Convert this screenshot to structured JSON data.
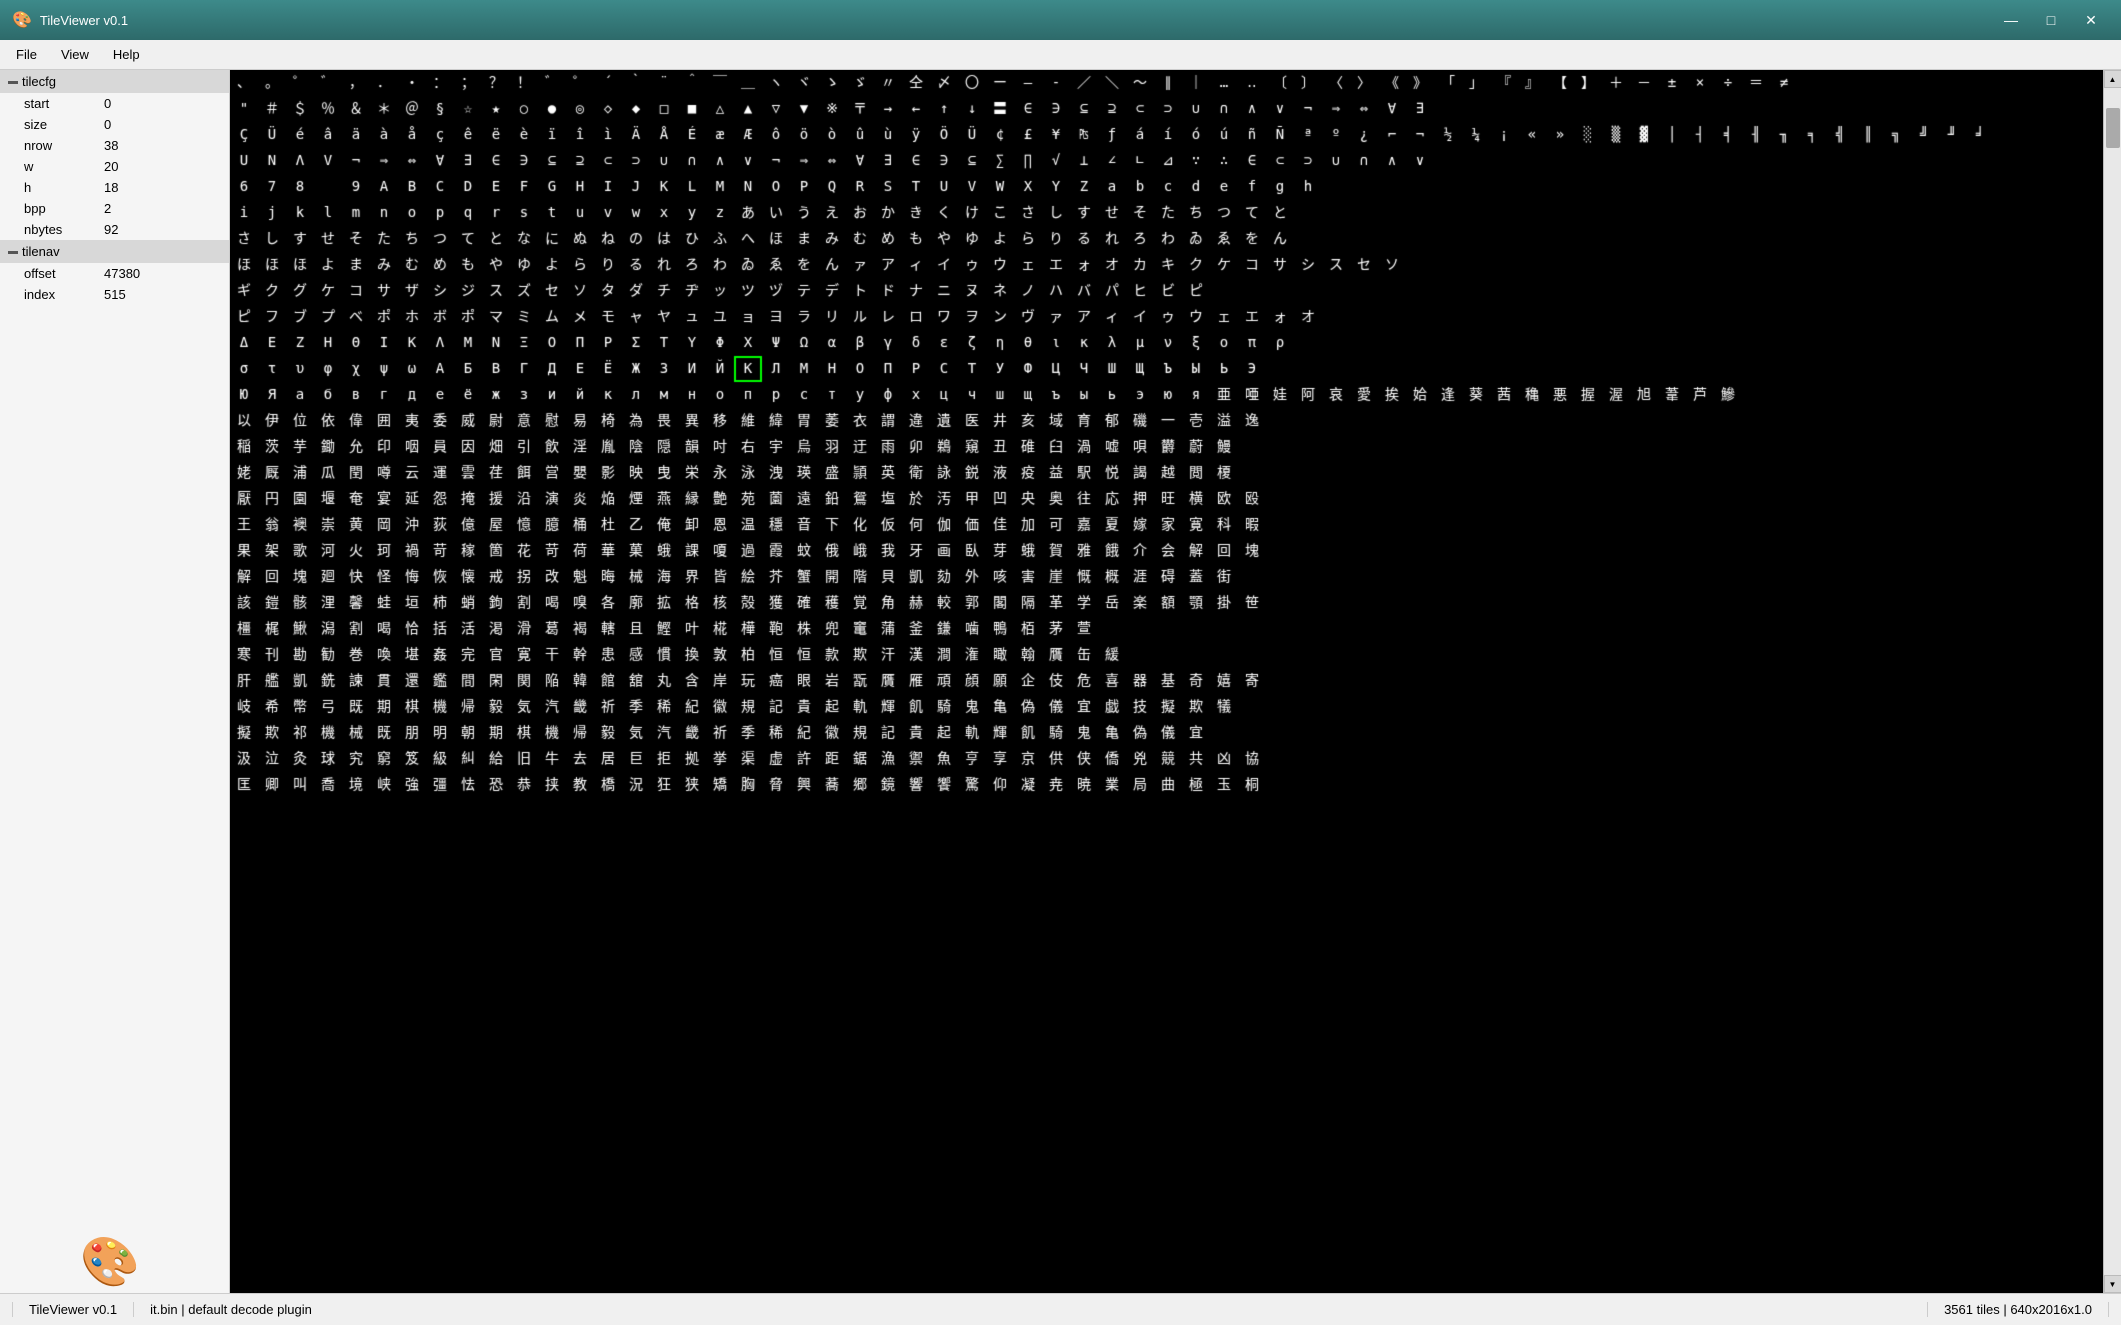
{
  "window": {
    "title": "TileViewer v0.1",
    "icon": "🎨"
  },
  "titlebar": {
    "minimize_label": "—",
    "maximize_label": "□",
    "close_label": "✕"
  },
  "menubar": {
    "items": [
      "File",
      "View",
      "Help"
    ]
  },
  "sidebar": {
    "sections": [
      {
        "id": "tilecfg",
        "label": "tilecfg",
        "rows": [
          {
            "label": "start",
            "value": "0"
          },
          {
            "label": "size",
            "value": "0"
          },
          {
            "label": "nrow",
            "value": "38"
          },
          {
            "label": "w",
            "value": "20"
          },
          {
            "label": "h",
            "value": "18"
          },
          {
            "label": "bpp",
            "value": "2"
          },
          {
            "label": "nbytes",
            "value": "92"
          }
        ]
      },
      {
        "id": "tilenav",
        "label": "tilenav",
        "rows": [
          {
            "label": "offset",
            "value": "47380"
          },
          {
            "label": "index",
            "value": "515"
          }
        ]
      }
    ]
  },
  "statusbar": {
    "app_name": "TileViewer v0.1",
    "file_info": "it.bin | default decode plugin",
    "tile_info": "3561 tiles | 640x2016x1.0"
  },
  "canvas": {
    "highlighted_cell_index": 64,
    "background": "#000000",
    "foreground": "#ffffff"
  }
}
